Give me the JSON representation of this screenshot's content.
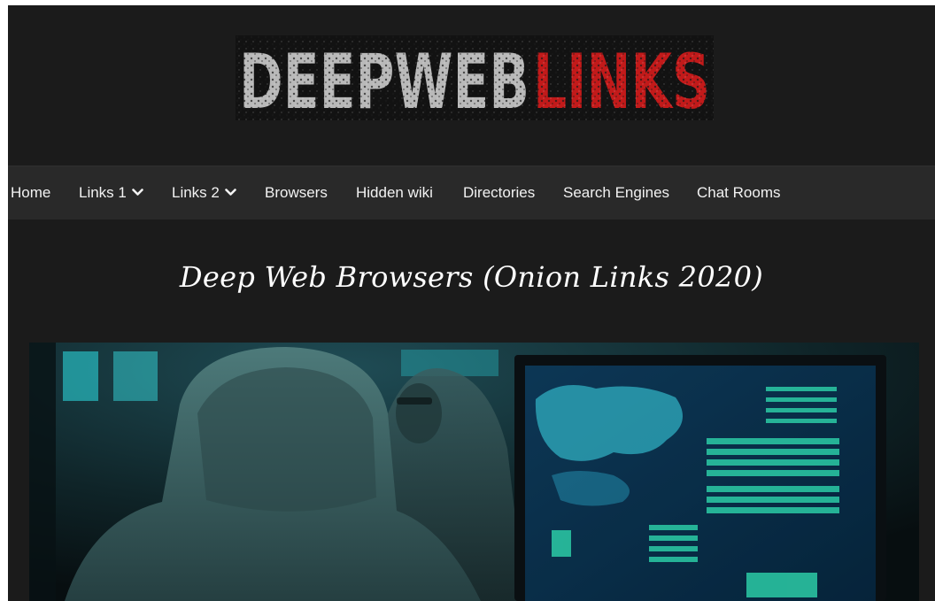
{
  "logo": {
    "word_left": "DEEPWEB",
    "word_right": "LINKS",
    "colors": {
      "left": "#b9b9b9",
      "right": "#c21a1a",
      "background": "#121212"
    },
    "icon": "site-logo"
  },
  "nav": {
    "items": [
      {
        "label": "Home",
        "dropdown": false
      },
      {
        "label": "Links 1",
        "dropdown": true
      },
      {
        "label": "Links 2",
        "dropdown": true
      },
      {
        "label": "Browsers",
        "dropdown": false
      },
      {
        "label": "Hidden wiki",
        "dropdown": false
      },
      {
        "label": "Directories",
        "dropdown": false
      },
      {
        "label": "Search Engines",
        "dropdown": false
      },
      {
        "label": "Chat Rooms",
        "dropdown": false
      }
    ],
    "dropdown_icon": "chevron-down-icon"
  },
  "page": {
    "title": "Deep Web Browsers (Onion Links 2020)"
  },
  "hero": {
    "icon": "hooded-hacker-at-computer-image"
  },
  "theme": {
    "background": "#1b1b1b",
    "nav_background": "#292929",
    "text": "#f2f2f2",
    "accent_cyan": "#2ee0c4"
  }
}
